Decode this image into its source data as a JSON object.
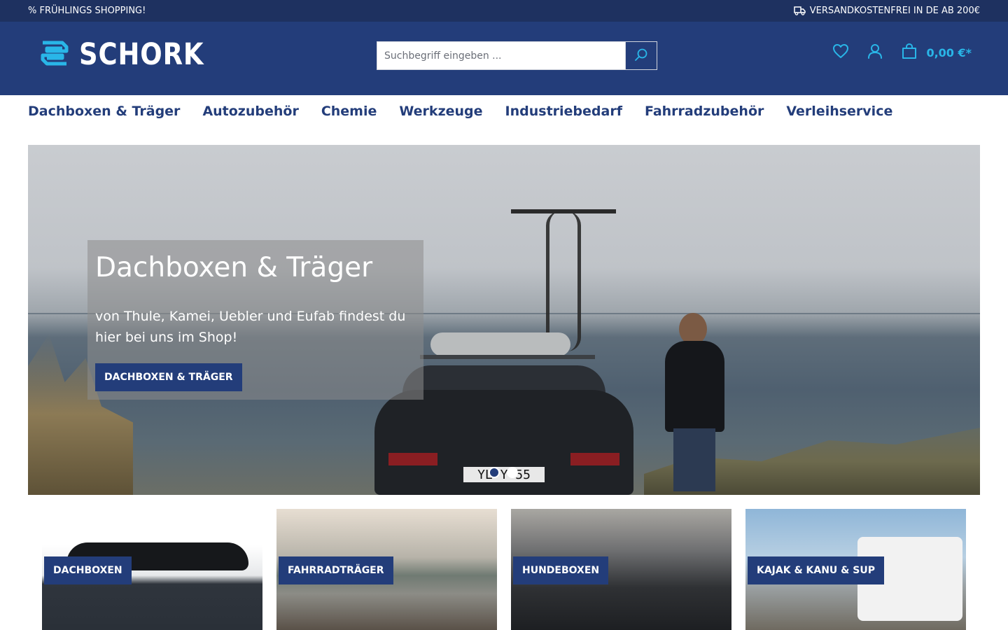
{
  "topbar": {
    "promo": "% FRÜHLINGS SHOPPING!",
    "shipping": "VERSANDKOSTENFREI IN DE AB 200€"
  },
  "header": {
    "logo_text": "SCHORK",
    "search_placeholder": "Suchbegriff eingeben ...",
    "cart_total": "0,00 €*"
  },
  "nav": {
    "items": [
      "Dachboxen & Träger",
      "Autozubehör",
      "Chemie",
      "Werkzeuge",
      "Industriebedarf",
      "Fahrradzubehör",
      "Verleihservice"
    ]
  },
  "hero": {
    "title": "Dachboxen & Träger",
    "text": "von Thule, Kamei, Uebler und Eufab findest du hier bei uns im Shop!",
    "button": "DACHBOXEN & TRÄGER",
    "plate": "YL Y 55"
  },
  "tiles": [
    {
      "label": "DACHBOXEN"
    },
    {
      "label": "FAHRRADTRÄGER"
    },
    {
      "label": "HUNDEBOXEN"
    },
    {
      "label": "KAJAK & KANU & SUP"
    }
  ],
  "colors": {
    "brand_dark": "#1e3160",
    "brand": "#233d7a",
    "accent": "#29b6e8"
  },
  "icons": [
    "truck-icon",
    "search-icon",
    "heart-icon",
    "user-icon",
    "cart-icon"
  ]
}
